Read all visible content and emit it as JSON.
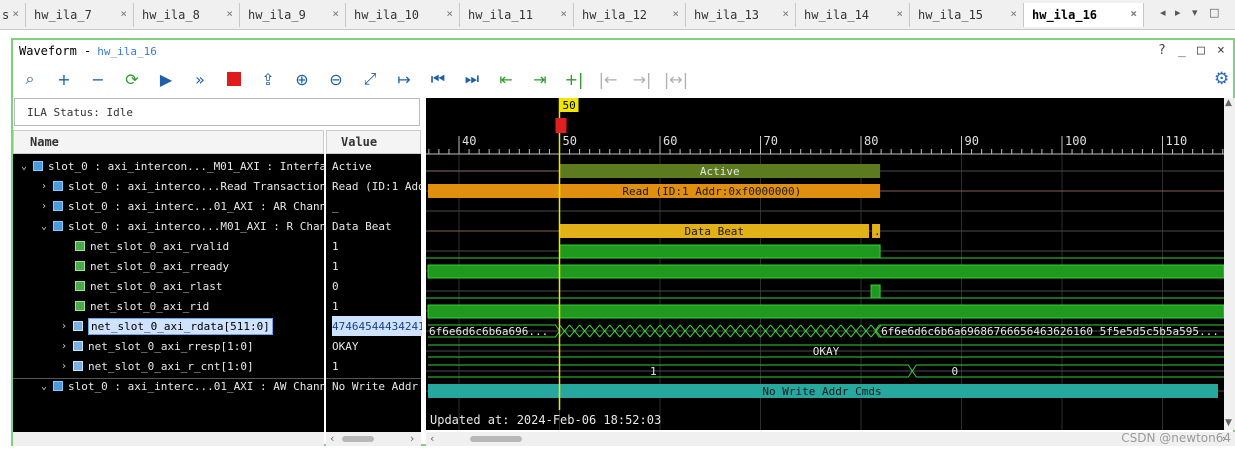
{
  "tabs": [
    {
      "label": "s",
      "active": false
    },
    {
      "label": "hw_ila_7",
      "active": false
    },
    {
      "label": "hw_ila_8",
      "active": false
    },
    {
      "label": "hw_ila_9",
      "active": false
    },
    {
      "label": "hw_ila_10",
      "active": false
    },
    {
      "label": "hw_ila_11",
      "active": false
    },
    {
      "label": "hw_ila_12",
      "active": false
    },
    {
      "label": "hw_ila_13",
      "active": false
    },
    {
      "label": "hw_ila_14",
      "active": false
    },
    {
      "label": "hw_ila_15",
      "active": false
    },
    {
      "label": "hw_ila_16",
      "active": true
    }
  ],
  "window": {
    "title": "Waveform -",
    "subtitle": "hw_ila_16",
    "controls": [
      "?",
      "_",
      "□",
      "×"
    ]
  },
  "toolbar": {
    "buttons": [
      {
        "name": "zoom-search-icon",
        "glyph": "⌕"
      },
      {
        "name": "add-icon",
        "glyph": "+"
      },
      {
        "name": "remove-icon",
        "glyph": "−"
      },
      {
        "name": "refresh-icon",
        "glyph": "⟳"
      },
      {
        "name": "run-trigger-icon",
        "glyph": "▶"
      },
      {
        "name": "run-immediate-icon",
        "glyph": "»"
      },
      {
        "name": "stop-icon",
        "glyph": ""
      },
      {
        "name": "export-icon",
        "glyph": "⇪"
      },
      {
        "name": "zoom-in-icon",
        "glyph": "⊕"
      },
      {
        "name": "zoom-out-icon",
        "glyph": "⊖"
      },
      {
        "name": "zoom-fit-icon",
        "glyph": "⤢"
      },
      {
        "name": "goto-cursor-icon",
        "glyph": "↦"
      },
      {
        "name": "goto-start-icon",
        "glyph": "⏮"
      },
      {
        "name": "goto-end-icon",
        "glyph": "⏭"
      },
      {
        "name": "previous-transition-icon",
        "glyph": "⇤"
      },
      {
        "name": "next-transition-icon",
        "glyph": "⇥"
      },
      {
        "name": "add-marker-icon",
        "glyph": "+|"
      },
      {
        "name": "previous-marker-icon",
        "glyph": "|←"
      },
      {
        "name": "next-marker-icon",
        "glyph": "→|"
      },
      {
        "name": "swap-cursors-icon",
        "glyph": "|↔|"
      }
    ],
    "settings_glyph": "⚙"
  },
  "status": "ILA Status: Idle",
  "columns": {
    "name": "Name",
    "value": "Value"
  },
  "signals": [
    {
      "name": "slot_0 : axi_intercon..._M01_AXI : Interface",
      "value": "Active",
      "indent": 0,
      "caret": "⌄",
      "type": "bus"
    },
    {
      "name": "slot_0 : axi_interco...Read Transactions",
      "value": "Read (ID:1 Addr",
      "indent": 1,
      "caret": "›",
      "type": "bus"
    },
    {
      "name": "slot_0 : axi_interc...01_AXI : AR Channel",
      "value": "_",
      "indent": 1,
      "caret": "›",
      "type": "bus"
    },
    {
      "name": "slot_0 : axi_interco...M01_AXI : R Channe",
      "value": "Data Beat",
      "indent": 1,
      "caret": "⌄",
      "type": "bus"
    },
    {
      "name": "net_slot_0_axi_rvalid",
      "value": "1",
      "indent": 2,
      "caret": "",
      "type": "bit"
    },
    {
      "name": "net_slot_0_axi_rready",
      "value": "1",
      "indent": 2,
      "caret": "",
      "type": "bit"
    },
    {
      "name": "net_slot_0_axi_rlast",
      "value": "0",
      "indent": 2,
      "caret": "",
      "type": "bit"
    },
    {
      "name": "net_slot_0_axi_rid",
      "value": "1",
      "indent": 2,
      "caret": "",
      "type": "bit"
    },
    {
      "name": "net_slot_0_axi_rdata[511:0]",
      "value": "474645444342414",
      "indent": 2,
      "caret": "›",
      "type": "vec",
      "selected": true
    },
    {
      "name": "net_slot_0_axi_rresp[1:0]",
      "value": "OKAY",
      "indent": 2,
      "caret": "›",
      "type": "vec"
    },
    {
      "name": "net_slot_0_axi_r_cnt[1:0]",
      "value": "1",
      "indent": 2,
      "caret": "›",
      "type": "vec"
    },
    {
      "name": "slot_0 : axi_interc...01_AXI : AW Channel",
      "value": "No Write Addr C",
      "indent": 1,
      "caret": "⌄",
      "type": "bus"
    }
  ],
  "wave": {
    "cursor_label": "50",
    "ruler_ticks": [
      "40",
      "50",
      "60",
      "70",
      "80",
      "90",
      "100",
      "110"
    ],
    "labels": {
      "active": "Active",
      "read": "Read (ID:1 Addr:0xf0000000)",
      "data_beat": "Data Beat",
      "data_beat_tail": ".",
      "rdata_before": "6f6e6d6c6b6a696...",
      "rdata_after": "6f6e6d6c6b6a69686766656463626160 5f5e5d5c5b5a595...",
      "rresp": "OKAY",
      "cnt_before": "1",
      "cnt_after": "0",
      "aw": "No Write Addr Cmds"
    },
    "updated": "Updated at: 2024-Feb-06 18:52:03",
    "colors": {
      "active": "#5c7a1e",
      "read": "#e0900e",
      "data_beat": "#e2b017",
      "bit": "#1f9a1f",
      "aw": "#26a89e",
      "cursor": "#f2e600",
      "cursor_box": "#e02020"
    }
  },
  "watermark": "CSDN @newton64"
}
